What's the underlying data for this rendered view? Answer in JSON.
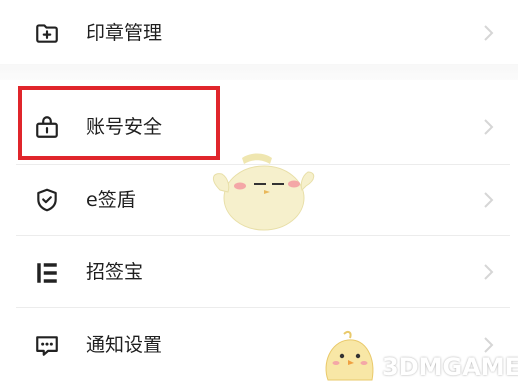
{
  "menu": {
    "items": [
      {
        "label": "印章管理",
        "icon": "seal-folder-plus-icon"
      },
      {
        "label": "账号安全",
        "icon": "account-security-lock-icon"
      },
      {
        "label": "e签盾",
        "icon": "shield-check-icon"
      },
      {
        "label": "招签宝",
        "icon": "bar-list-icon"
      },
      {
        "label": "通知设置",
        "icon": "message-dots-icon"
      }
    ],
    "highlight_color": "#e0252b"
  },
  "watermark": {
    "text": "3DMGAME"
  }
}
